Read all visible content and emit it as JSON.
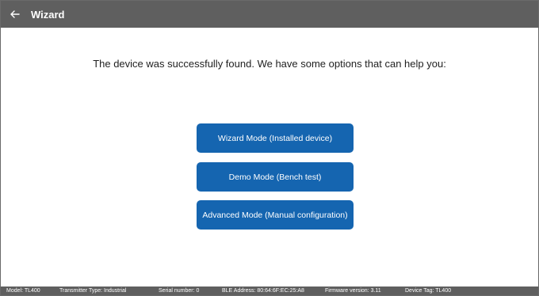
{
  "header": {
    "back_icon": "arrow-left-icon",
    "title": "Wizard",
    "background_color": "#5f5f5f"
  },
  "main": {
    "message": "The device was successfully found. We have some options that can help you:",
    "buttons": {
      "wizard_mode": "Wizard Mode (Installed device)",
      "demo_mode": "Demo Mode (Bench test)",
      "advanced_mode": "Advanced Mode (Manual configuration)"
    },
    "button_color": "#1565b0"
  },
  "status_bar": {
    "model": "Model: TL400",
    "transmitter_type": "Transmitter Type: Industrial",
    "serial_number": "Serial number: 0",
    "ble_address": "BLE Address: 80:64:6F:EC:25:A8",
    "firmware_version": "Firmware version: 3.11",
    "device_tag": "Device Tag: TL400"
  }
}
